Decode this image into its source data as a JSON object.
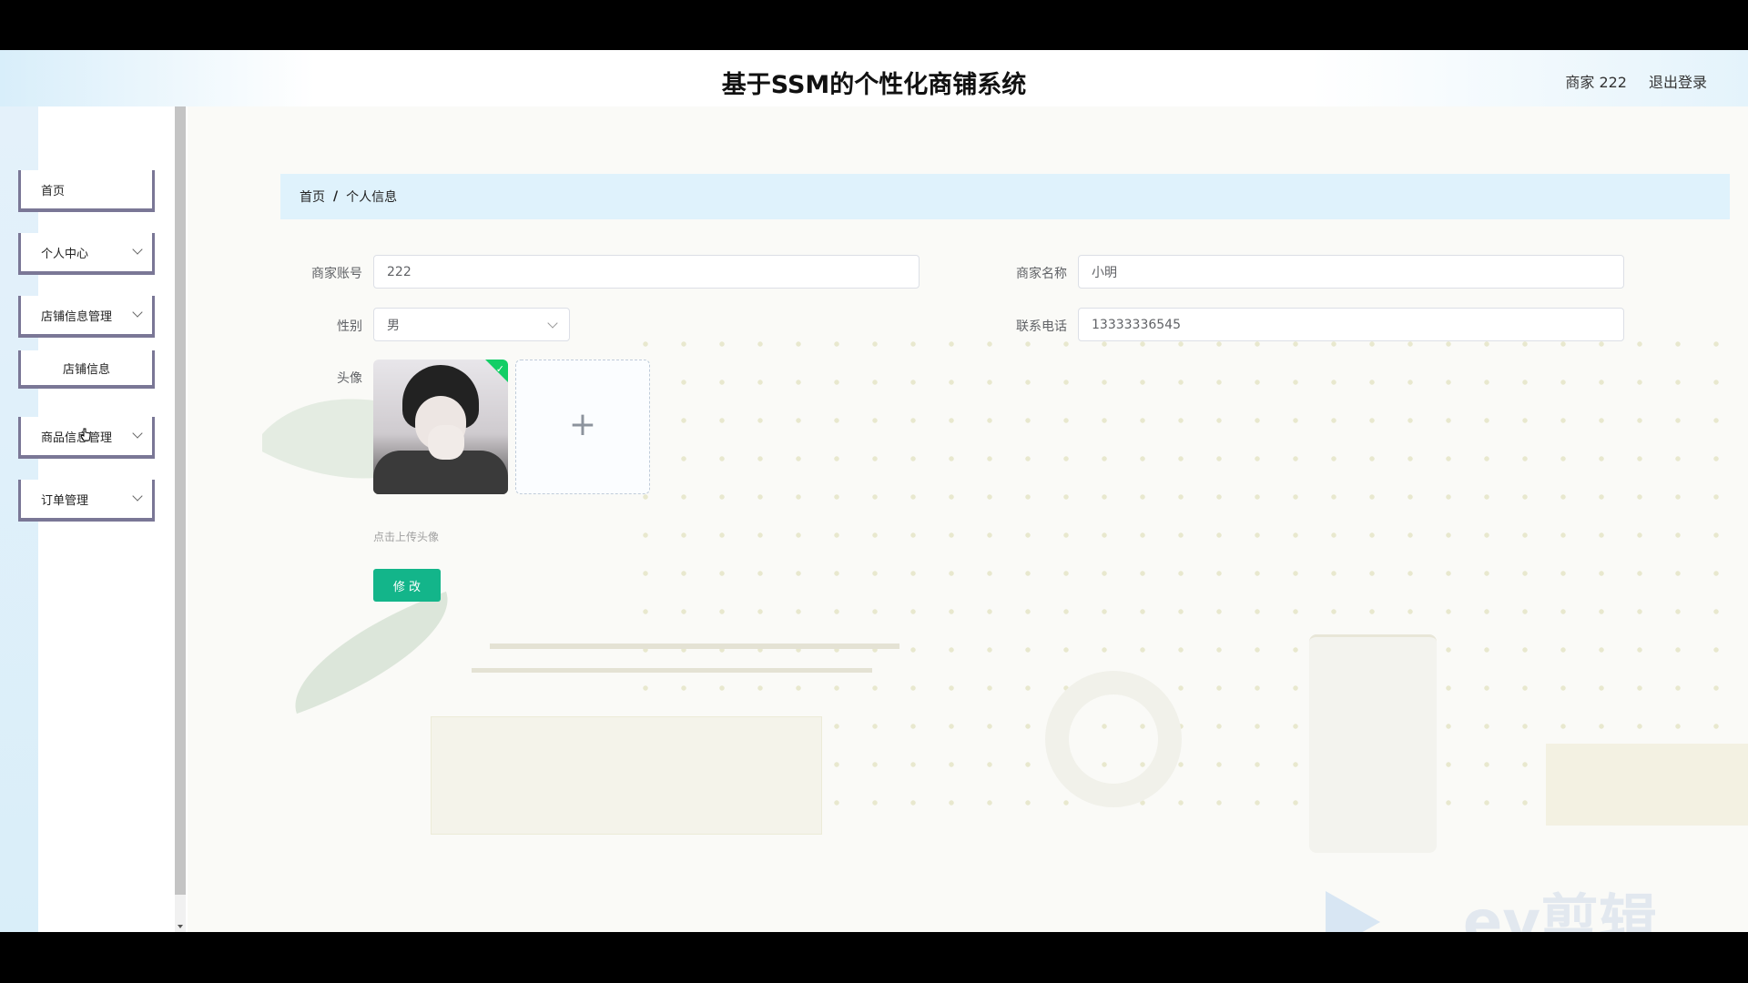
{
  "header": {
    "title": "基于SSM的个性化商铺系统",
    "user": "商家 222",
    "logout": "退出登录"
  },
  "sidebar": {
    "items": [
      {
        "label": "首页"
      },
      {
        "label": "个人中心"
      },
      {
        "label": "店铺信息管理"
      },
      {
        "label": "店铺信息"
      },
      {
        "label": "商品信息管理"
      },
      {
        "label": "订单管理"
      }
    ]
  },
  "breadcrumb": {
    "home": "首页",
    "separator": "/",
    "current": "个人信息"
  },
  "form": {
    "account_label": "商家账号",
    "account_value": "222",
    "name_label": "商家名称",
    "name_value": "小明",
    "gender_label": "性别",
    "gender_value": "男",
    "phone_label": "联系电话",
    "phone_value": "13333336545",
    "avatar_label": "头像",
    "upload_hint": "点击上传头像",
    "submit_label": "修 改"
  },
  "watermark": "ev剪辑",
  "colors": {
    "accent_green": "#13b58a",
    "breadcrumb_bg": "#dff2fc",
    "menu_border": "#7a7796"
  }
}
